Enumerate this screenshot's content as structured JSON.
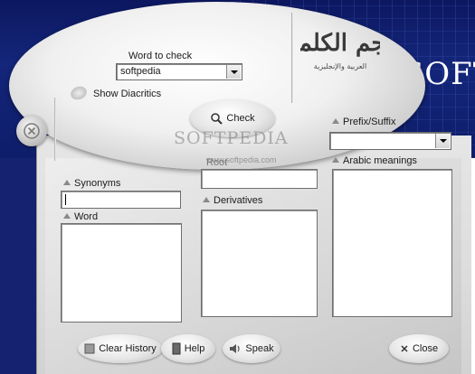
{
  "background": {
    "brand_text": "SOFT"
  },
  "header": {
    "word_to_check_label": "Word to check",
    "word_value": "softpedia",
    "show_diacritics_label": "Show Diacritics",
    "check_label": "Check",
    "logo_text": "مُعجم الكلمات",
    "logo_subtitle": "العربية والإنجليزية"
  },
  "watermark": {
    "text": "SOFTPEDIA",
    "url": "www.softpedia.com"
  },
  "panels": {
    "synonyms_label": "Synonyms",
    "synonyms_value": "",
    "word_label": "Word",
    "root_label": "Root",
    "root_value": "",
    "derivatives_label": "Derivatives",
    "prefix_suffix_label": "Prefix/Suffix",
    "prefix_suffix_value": "",
    "arabic_meanings_label": "Arabic meanings"
  },
  "footer": {
    "clear_history_label": "Clear History",
    "help_label": "Help",
    "speak_label": "Speak",
    "close_label": "Close"
  }
}
